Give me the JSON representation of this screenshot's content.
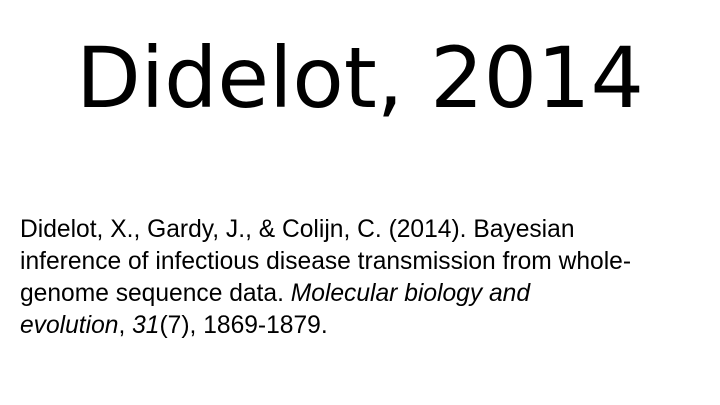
{
  "slide": {
    "title": "Didelot, 2014",
    "citation": {
      "line1": "Didelot, X., Gardy, J., & Colijn, C. (2014). Bayesian",
      "line2": "inference of infectious disease transmission from whole-",
      "line3_plain": "genome sequence data. ",
      "journal_part1": "Molecular biology and",
      "journal_part2": "evolution",
      "sep1": ", ",
      "volume": "31",
      "issue": "(7)",
      "pages": ", 1869-1879."
    }
  }
}
